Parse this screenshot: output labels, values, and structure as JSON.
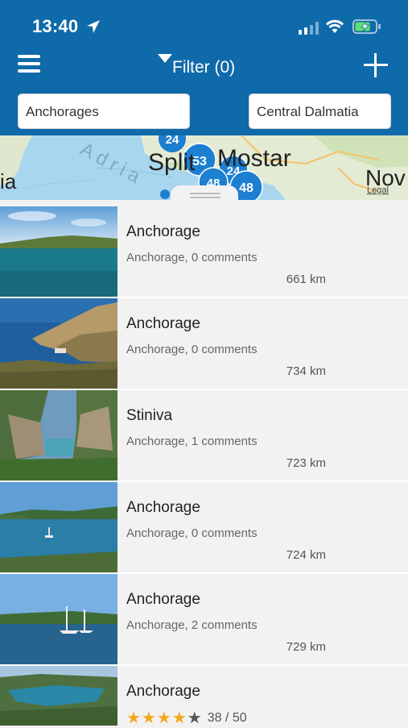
{
  "status": {
    "time": "13:40"
  },
  "nav": {
    "filter_label": "Filter (0)"
  },
  "search": {
    "type_value": "Anchorages",
    "region_value": "Central Dalmatia"
  },
  "map": {
    "labels": [
      "Split",
      "Mostar",
      "Adria",
      "Nov",
      "ia"
    ],
    "clusters": [
      "24",
      "53",
      "24",
      "48",
      "48"
    ],
    "legal": "Legal"
  },
  "list": {
    "items": [
      {
        "title": "Anchorage",
        "subtitle": "Anchorage, 0 comments",
        "distance": "661 km"
      },
      {
        "title": "Anchorage",
        "subtitle": "Anchorage, 0 comments",
        "distance": "734 km"
      },
      {
        "title": "Stiniva",
        "subtitle": "Anchorage, 1 comments",
        "distance": "723 km"
      },
      {
        "title": "Anchorage",
        "subtitle": "Anchorage, 0 comments",
        "distance": "724 km"
      },
      {
        "title": "Anchorage",
        "subtitle": "Anchorage, 2 comments",
        "distance": "729 km"
      },
      {
        "title": "Anchorage",
        "rating_text": "38 / 50",
        "rating_stars": 4
      }
    ]
  },
  "colors": {
    "header": "#0f6aaa",
    "star": "#f2a81d",
    "cluster": "#1d7fd1"
  }
}
